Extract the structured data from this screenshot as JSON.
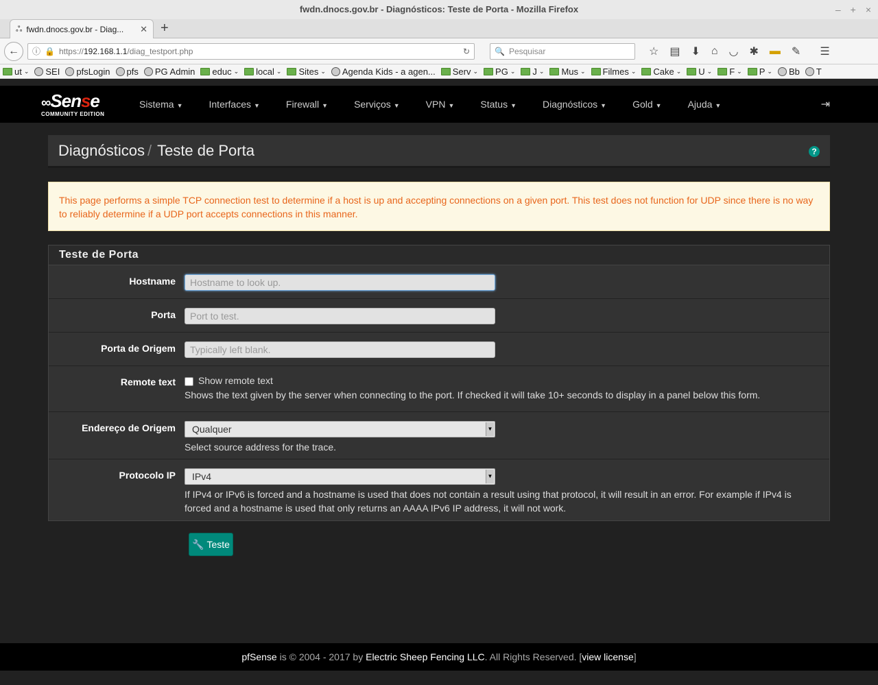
{
  "browser": {
    "window_title": "fwdn.dnocs.gov.br - Diagnósticos: Teste de Porta - Mozilla Firefox",
    "tab_title": "fwdn.dnocs.gov.br - Diag...",
    "url_prefix": "https://",
    "url_host": "192.168.1.1",
    "url_path": "/diag_testport.php",
    "search_placeholder": "Pesquisar",
    "bookmarks": [
      {
        "label": "ut",
        "type": "folder",
        "dropdown": true
      },
      {
        "label": "SEI",
        "type": "site"
      },
      {
        "label": "pfsLogin",
        "type": "site"
      },
      {
        "label": "pfs",
        "type": "site"
      },
      {
        "label": "PG Admin",
        "type": "site"
      },
      {
        "label": "educ",
        "type": "folder",
        "dropdown": true
      },
      {
        "label": "local",
        "type": "folder",
        "dropdown": true
      },
      {
        "label": "Sites",
        "type": "folder",
        "dropdown": true
      },
      {
        "label": "Agenda Kids - a agen...",
        "type": "site"
      },
      {
        "label": "Serv",
        "type": "folder",
        "dropdown": true
      },
      {
        "label": "PG",
        "type": "folder",
        "dropdown": true
      },
      {
        "label": "J",
        "type": "folder",
        "dropdown": true
      },
      {
        "label": "Mus",
        "type": "folder",
        "dropdown": true
      },
      {
        "label": "Filmes",
        "type": "folder",
        "dropdown": true
      },
      {
        "label": "Cake",
        "type": "folder",
        "dropdown": true
      },
      {
        "label": "U",
        "type": "folder",
        "dropdown": true
      },
      {
        "label": "F",
        "type": "folder",
        "dropdown": true
      },
      {
        "label": "P",
        "type": "folder",
        "dropdown": true
      },
      {
        "label": "Bb",
        "type": "site"
      },
      {
        "label": "T",
        "type": "site"
      }
    ]
  },
  "pfsense": {
    "logo_text": "Sense",
    "logo_sub": "COMMUNITY EDITION",
    "menu": [
      "Sistema",
      "Interfaces",
      "Firewall",
      "Serviços",
      "VPN",
      "Status",
      "Diagnósticos",
      "Gold",
      "Ajuda"
    ],
    "accent_color": "#00897b",
    "warning_color": "#e8661c"
  },
  "breadcrumb": {
    "parent": "Diagnósticos",
    "separator": "/",
    "current": "Teste de Porta"
  },
  "alert_text": "This page performs a simple TCP connection test to determine if a host is up and accepting connections on a given port. This test does not function for UDP since there is no way to reliably determine if a UDP port accepts connections in this manner.",
  "form": {
    "panel_title": "Teste de Porta",
    "hostname": {
      "label": "Hostname",
      "value": "",
      "placeholder": "Hostname to look up."
    },
    "porta": {
      "label": "Porta",
      "value": "",
      "placeholder": "Port to test."
    },
    "porta_origem": {
      "label": "Porta de Origem",
      "value": "",
      "placeholder": "Typically left blank."
    },
    "remote_text": {
      "label": "Remote text",
      "checkbox_label": "Show remote text",
      "checked": false,
      "help": "Shows the text given by the server when connecting to the port. If checked it will take 10+ seconds to display in a panel below this form."
    },
    "endereco_origem": {
      "label": "Endereço de Origem",
      "selected": "Qualquer",
      "help": "Select source address for the trace."
    },
    "protocolo_ip": {
      "label": "Protocolo IP",
      "selected": "IPv4",
      "help": "If IPv4 or IPv6 is forced and a hostname is used that does not contain a result using that protocol, it will result in an error. For example if IPv4 is forced and a hostname is used that only returns an AAAA IPv6 IP address, it will not work."
    },
    "submit_label": "Teste"
  },
  "footer": {
    "brand": "pfSense",
    "copy": " is © 2004 - 2017 by ",
    "company": "Electric Sheep Fencing LLC",
    "rights": ". All Rights Reserved. [",
    "license": "view license",
    "close": "]"
  }
}
